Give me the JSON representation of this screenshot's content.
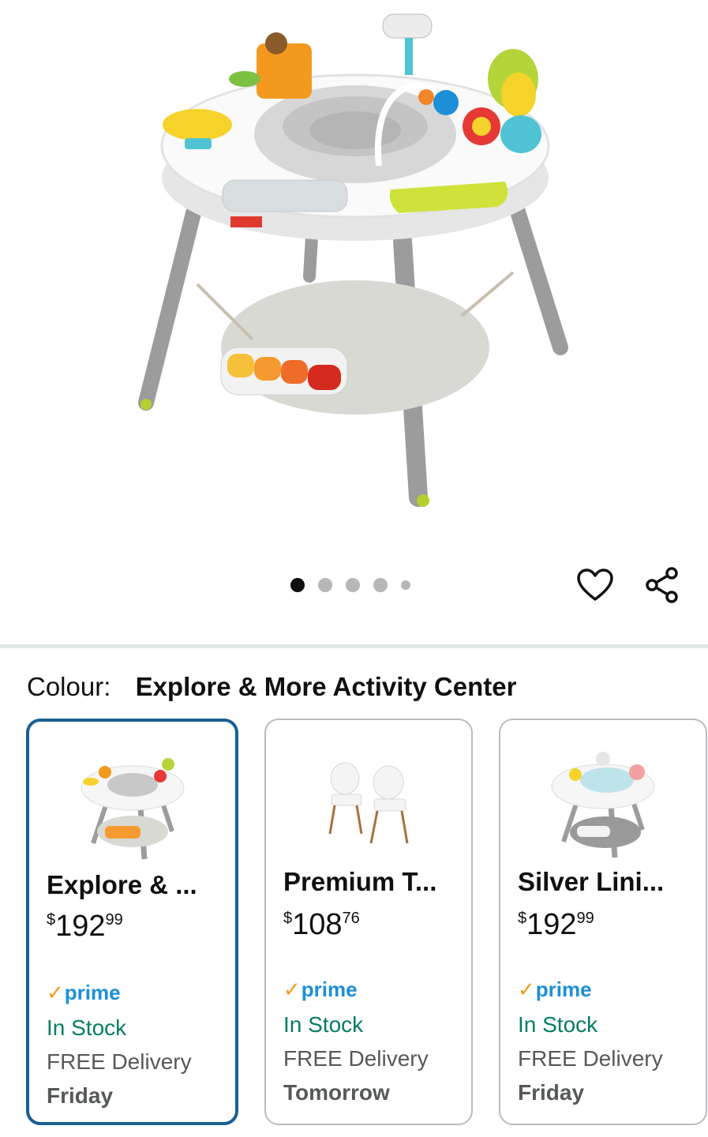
{
  "product_image": {
    "alt": "Skip Hop activity center"
  },
  "carousel": {
    "count": 5,
    "active_index": 0
  },
  "actions": {
    "wishlist_icon": "heart-icon",
    "share_icon": "share-icon"
  },
  "colour": {
    "label": "Colour:",
    "value": "Explore & More Activity Center"
  },
  "options": [
    {
      "name": "Explore & ...",
      "currency": "$",
      "whole": "192",
      "fraction": "99",
      "prime": "prime",
      "stock": "In Stock",
      "delivery": "FREE Delivery",
      "day": "Friday",
      "selected": true
    },
    {
      "name": "Premium T...",
      "currency": "$",
      "whole": "108",
      "fraction": "76",
      "prime": "prime",
      "stock": "In Stock",
      "delivery": "FREE Delivery",
      "day": "Tomorrow",
      "selected": false
    },
    {
      "name": "Silver Lini...",
      "currency": "$",
      "whole": "192",
      "fraction": "99",
      "prime": "prime",
      "stock": "In Stock",
      "delivery": "FREE Delivery",
      "day": "Friday",
      "selected": false
    }
  ],
  "colors": {
    "selected_border": "#1a5f93",
    "prime_blue": "#1c8fd8",
    "prime_check": "#f29a1c",
    "stock_green": "#067d62"
  }
}
